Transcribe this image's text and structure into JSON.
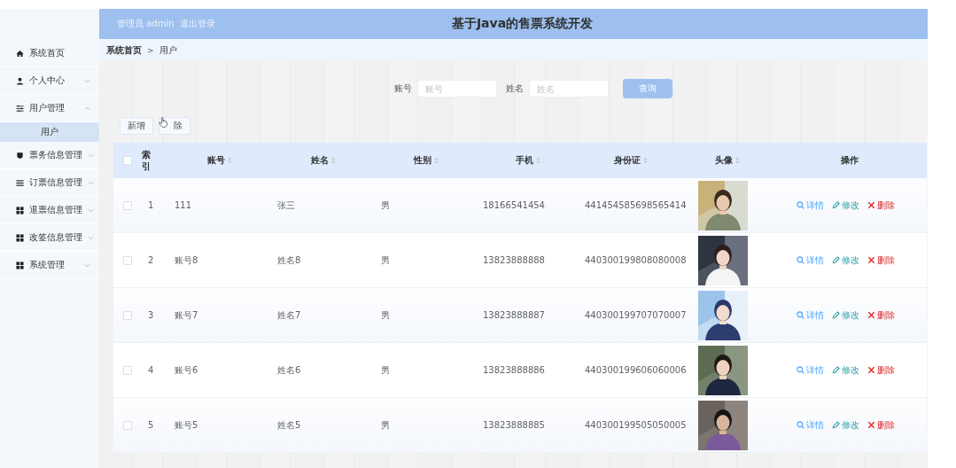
{
  "header": {
    "user": "管理员 admin",
    "logout": "退出登录",
    "title": "基于Java的售票系统开发"
  },
  "sidebar": {
    "items": [
      {
        "label": "系统首页",
        "kind": "link"
      },
      {
        "label": "个人中心",
        "kind": "menu",
        "expanded": false
      },
      {
        "label": "用户管理",
        "kind": "menu",
        "expanded": true,
        "children": [
          {
            "label": "用户",
            "selected": true
          }
        ]
      },
      {
        "label": "票务信息管理",
        "kind": "menu",
        "expanded": false
      },
      {
        "label": "订票信息管理",
        "kind": "menu",
        "expanded": false
      },
      {
        "label": "退票信息管理",
        "kind": "menu",
        "expanded": false
      },
      {
        "label": "改签信息管理",
        "kind": "menu",
        "expanded": false
      },
      {
        "label": "系统管理",
        "kind": "menu",
        "expanded": false
      }
    ]
  },
  "breadcrumb": {
    "items": [
      "系统首页",
      "用户"
    ],
    "separator": ">"
  },
  "search": {
    "fields": [
      {
        "label": "账号",
        "placeholder": "账号"
      },
      {
        "label": "姓名",
        "placeholder": "姓名"
      }
    ],
    "button": "查询"
  },
  "toolbar": [
    "新增",
    "除"
  ],
  "table": {
    "select_all": {
      "checked": false
    },
    "columns": [
      {
        "label": "索引",
        "sortable": false
      },
      {
        "label": "账号",
        "sortable": true
      },
      {
        "label": "姓名",
        "sortable": true
      },
      {
        "label": "性别",
        "sortable": true
      },
      {
        "label": "手机",
        "sortable": true
      },
      {
        "label": "身份证",
        "sortable": true
      },
      {
        "label": "头像",
        "sortable": true
      },
      {
        "label": "操作",
        "sortable": false
      }
    ],
    "rows": [
      {
        "checked": false,
        "index": "1",
        "account": "111",
        "name": "张三",
        "gender": "男",
        "phone": "18166541454",
        "id_card": "441454585698565414",
        "actions": [
          "详情",
          "修改",
          "删除"
        ]
      },
      {
        "checked": false,
        "index": "2",
        "account": "账号8",
        "name": "姓名8",
        "gender": "男",
        "phone": "13823888888",
        "id_card": "440300199808080008",
        "actions": [
          "详情",
          "修改",
          "删除"
        ]
      },
      {
        "checked": false,
        "index": "3",
        "account": "账号7",
        "name": "姓名7",
        "gender": "男",
        "phone": "13823888887",
        "id_card": "440300199707070007",
        "actions": [
          "详情",
          "修改",
          "删除"
        ]
      },
      {
        "checked": false,
        "index": "4",
        "account": "账号6",
        "name": "姓名6",
        "gender": "男",
        "phone": "13823888886",
        "id_card": "440300199606060006",
        "actions": [
          "详情",
          "修改",
          "删除"
        ]
      },
      {
        "checked": false,
        "index": "5",
        "account": "账号5",
        "name": "姓名5",
        "gender": "男",
        "phone": "13823888885",
        "id_card": "440300199505050005",
        "actions": [
          "详情",
          "修改",
          "删除"
        ]
      }
    ]
  }
}
